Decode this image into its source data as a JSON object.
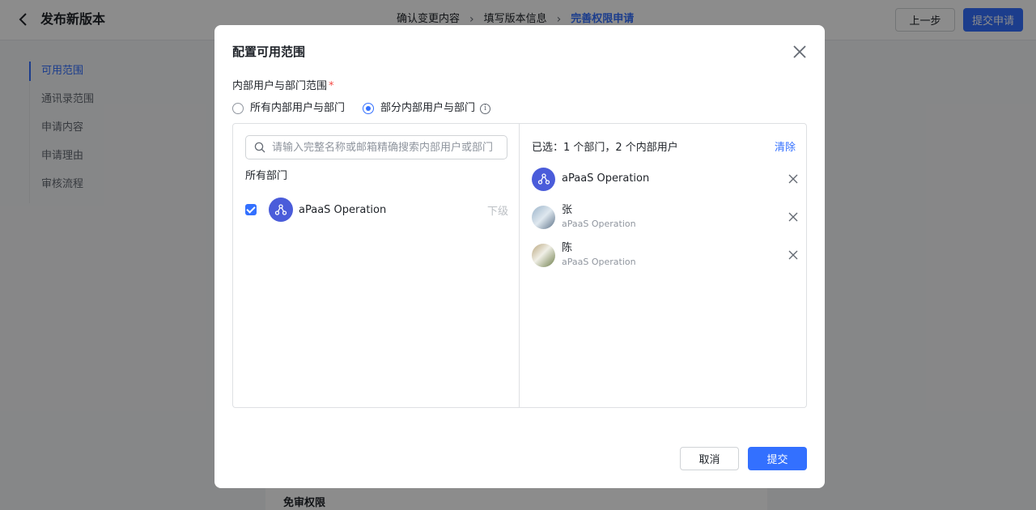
{
  "header": {
    "title": "发布新版本",
    "steps": [
      "确认变更内容",
      "填写版本信息",
      "完善权限申请"
    ],
    "prev_label": "上一步",
    "submit_label": "提交申请"
  },
  "sidenav": {
    "items": [
      "可用范围",
      "通讯录范围",
      "申请内容",
      "申请理由",
      "审核流程"
    ]
  },
  "content": {
    "section_label": "免审权限"
  },
  "modal": {
    "title": "配置可用范围",
    "field_label": "内部用户与部门范围",
    "required_mark": "*",
    "radio_all": "所有内部用户与部门",
    "radio_partial": "部分内部用户与部门",
    "search_placeholder": "请输入完整名称或邮箱精确搜索内部用户或部门",
    "dept_heading": "所有部门",
    "departments": [
      {
        "name": "aPaaS Operation",
        "checked": true,
        "sub_label": "下级"
      }
    ],
    "selected_summary": "已选：1 个部门，2 个内部用户",
    "clear_label": "清除",
    "selected": [
      {
        "name": "aPaaS Operation",
        "sub": ""
      },
      {
        "name": "张",
        "sub": "aPaaS Operation"
      },
      {
        "name": "陈",
        "sub": "aPaaS Operation"
      }
    ],
    "cancel_label": "取消",
    "ok_label": "提交"
  },
  "colors": {
    "accent": "#3370ff",
    "dept_avatar": "#4a5cda",
    "required": "#f54a45"
  }
}
